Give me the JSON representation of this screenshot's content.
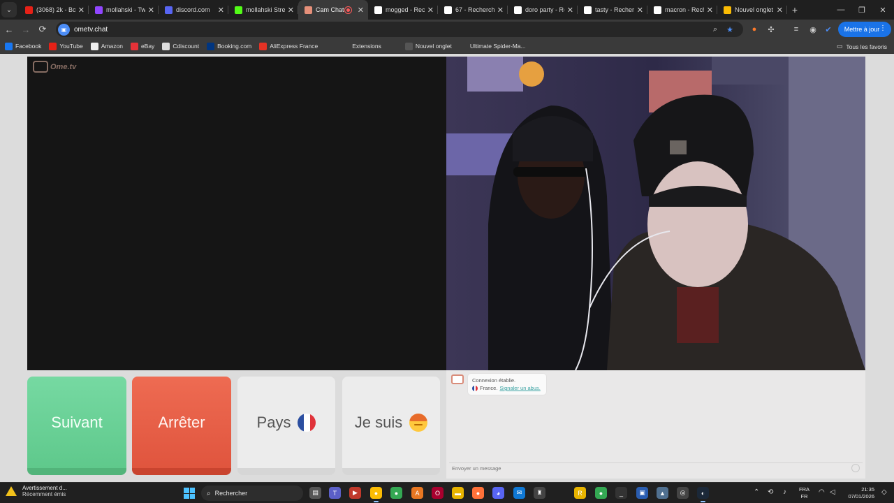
{
  "browser": {
    "tabs": [
      {
        "title": "(3068) 2k - Bo",
        "favicon": "youtube-icon",
        "color": "#e62117"
      },
      {
        "title": "mollahski - Twi",
        "favicon": "twitch-icon",
        "color": "#9146ff"
      },
      {
        "title": "discord.com",
        "favicon": "discord-icon",
        "color": "#5865f2"
      },
      {
        "title": "mollahski Strea",
        "favicon": "kick-icon",
        "color": "#53fc18"
      },
      {
        "title": "Cam Chat",
        "favicon": "ometv-icon",
        "color": "#e6907a",
        "active": true,
        "recording": true
      },
      {
        "title": "mogged - Rech",
        "favicon": "google-icon",
        "color": "#ffffff"
      },
      {
        "title": "67 - Recherche",
        "favicon": "google-icon",
        "color": "#ffffff"
      },
      {
        "title": "doro party - Re",
        "favicon": "google-icon",
        "color": "#ffffff"
      },
      {
        "title": "tasty - Recherc",
        "favicon": "google-icon",
        "color": "#ffffff"
      },
      {
        "title": "macron - Rech",
        "favicon": "google-icon",
        "color": "#ffffff"
      },
      {
        "title": "Nouvel onglet",
        "favicon": "chrome-icon",
        "color": "#fbbc04"
      }
    ],
    "url": "ometv.chat",
    "update_button": "Mettre à jour",
    "bookmarks": [
      {
        "label": "Facebook",
        "icon": "facebook-icon",
        "color": "#1877f2"
      },
      {
        "label": "YouTube",
        "icon": "youtube-icon",
        "color": "#e62117"
      },
      {
        "label": "Amazon",
        "icon": "amazon-icon",
        "color": "#eeeeee"
      },
      {
        "label": "eBay",
        "icon": "ebay-icon",
        "color": "#e53238"
      },
      {
        "label": "Cdiscount",
        "icon": "cdiscount-icon",
        "color": "#dddddd"
      },
      {
        "label": "Booking.com",
        "icon": "booking-icon",
        "color": "#003580"
      },
      {
        "label": "AliExpress France",
        "icon": "aliexpress-icon",
        "color": "#e43225"
      },
      {
        "label": "",
        "icon": "globe-icon",
        "color": "#3a3a3a"
      },
      {
        "label": "Extensions",
        "icon": "puzzle-icon",
        "color": "#3a3a3a"
      },
      {
        "label": "",
        "icon": "globe-icon",
        "color": "#3a3a3a"
      },
      {
        "label": "Nouvel onglet",
        "icon": "page-icon",
        "color": "#555555"
      },
      {
        "label": "Ultimate Spider-Ma...",
        "icon": "spider-icon",
        "color": "#3a3a3a"
      }
    ],
    "all_bookmarks": "Tous les favoris"
  },
  "page": {
    "logo_text": "Ome.tv",
    "buttons": {
      "next": "Suivant",
      "stop": "Arrêter",
      "country": "Pays",
      "gender": "Je suis"
    },
    "chat": {
      "status": "Connexion établie.",
      "country": "France.",
      "report_link": "Signaler un abus.",
      "input_placeholder": "Envoyer un message"
    }
  },
  "taskbar": {
    "notification_title": "Avertissement d...",
    "notification_sub": "Récemment émis",
    "search_placeholder": "Rechercher",
    "lang_top": "FRA",
    "lang_bottom": "FR",
    "time": "21:35",
    "date": "07/01/2026"
  },
  "colors": {
    "next": "#6fd49b",
    "stop": "#e65b43",
    "accent_blue": "#1a73e8"
  }
}
